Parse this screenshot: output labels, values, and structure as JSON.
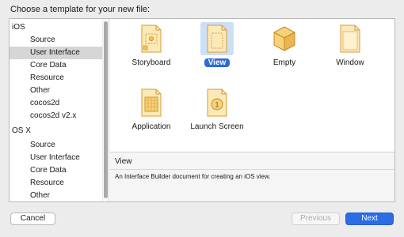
{
  "prompt": "Choose a template for your new file:",
  "sidebar": {
    "rows": [
      {
        "kind": "group",
        "label": "iOS"
      },
      {
        "kind": "item",
        "label": "Source"
      },
      {
        "kind": "item",
        "label": "User Interface",
        "selected": true
      },
      {
        "kind": "item",
        "label": "Core Data"
      },
      {
        "kind": "item",
        "label": "Resource"
      },
      {
        "kind": "item",
        "label": "Other"
      },
      {
        "kind": "item",
        "label": "cocos2d"
      },
      {
        "kind": "item",
        "label": "cocos2d v2.x"
      },
      {
        "kind": "group",
        "label": "OS X"
      },
      {
        "kind": "item",
        "label": "Source"
      },
      {
        "kind": "item",
        "label": "User Interface"
      },
      {
        "kind": "item",
        "label": "Core Data"
      },
      {
        "kind": "item",
        "label": "Resource"
      },
      {
        "kind": "item",
        "label": "Other"
      }
    ]
  },
  "templates": [
    {
      "label": "Storyboard",
      "icon": "storyboard-icon"
    },
    {
      "label": "View",
      "icon": "view-icon",
      "selected": true
    },
    {
      "label": "Empty",
      "icon": "empty-icon"
    },
    {
      "label": "Window",
      "icon": "window-icon"
    },
    {
      "label": "Application",
      "icon": "application-icon"
    },
    {
      "label": "Launch Screen",
      "icon": "launch-screen-icon",
      "badge": "1"
    }
  ],
  "description": {
    "title": "View",
    "text": "An Interface Builder document for creating an iOS view."
  },
  "buttons": {
    "cancel": "Cancel",
    "previous": "Previous",
    "next": "Next"
  },
  "colors": {
    "accent": "#2b6ee4",
    "selection_bg": "#cddff5",
    "sidebar_selection": "#d6d6d6",
    "icon_orange": "#e9a23b",
    "icon_paper": "#fbe9b8"
  }
}
